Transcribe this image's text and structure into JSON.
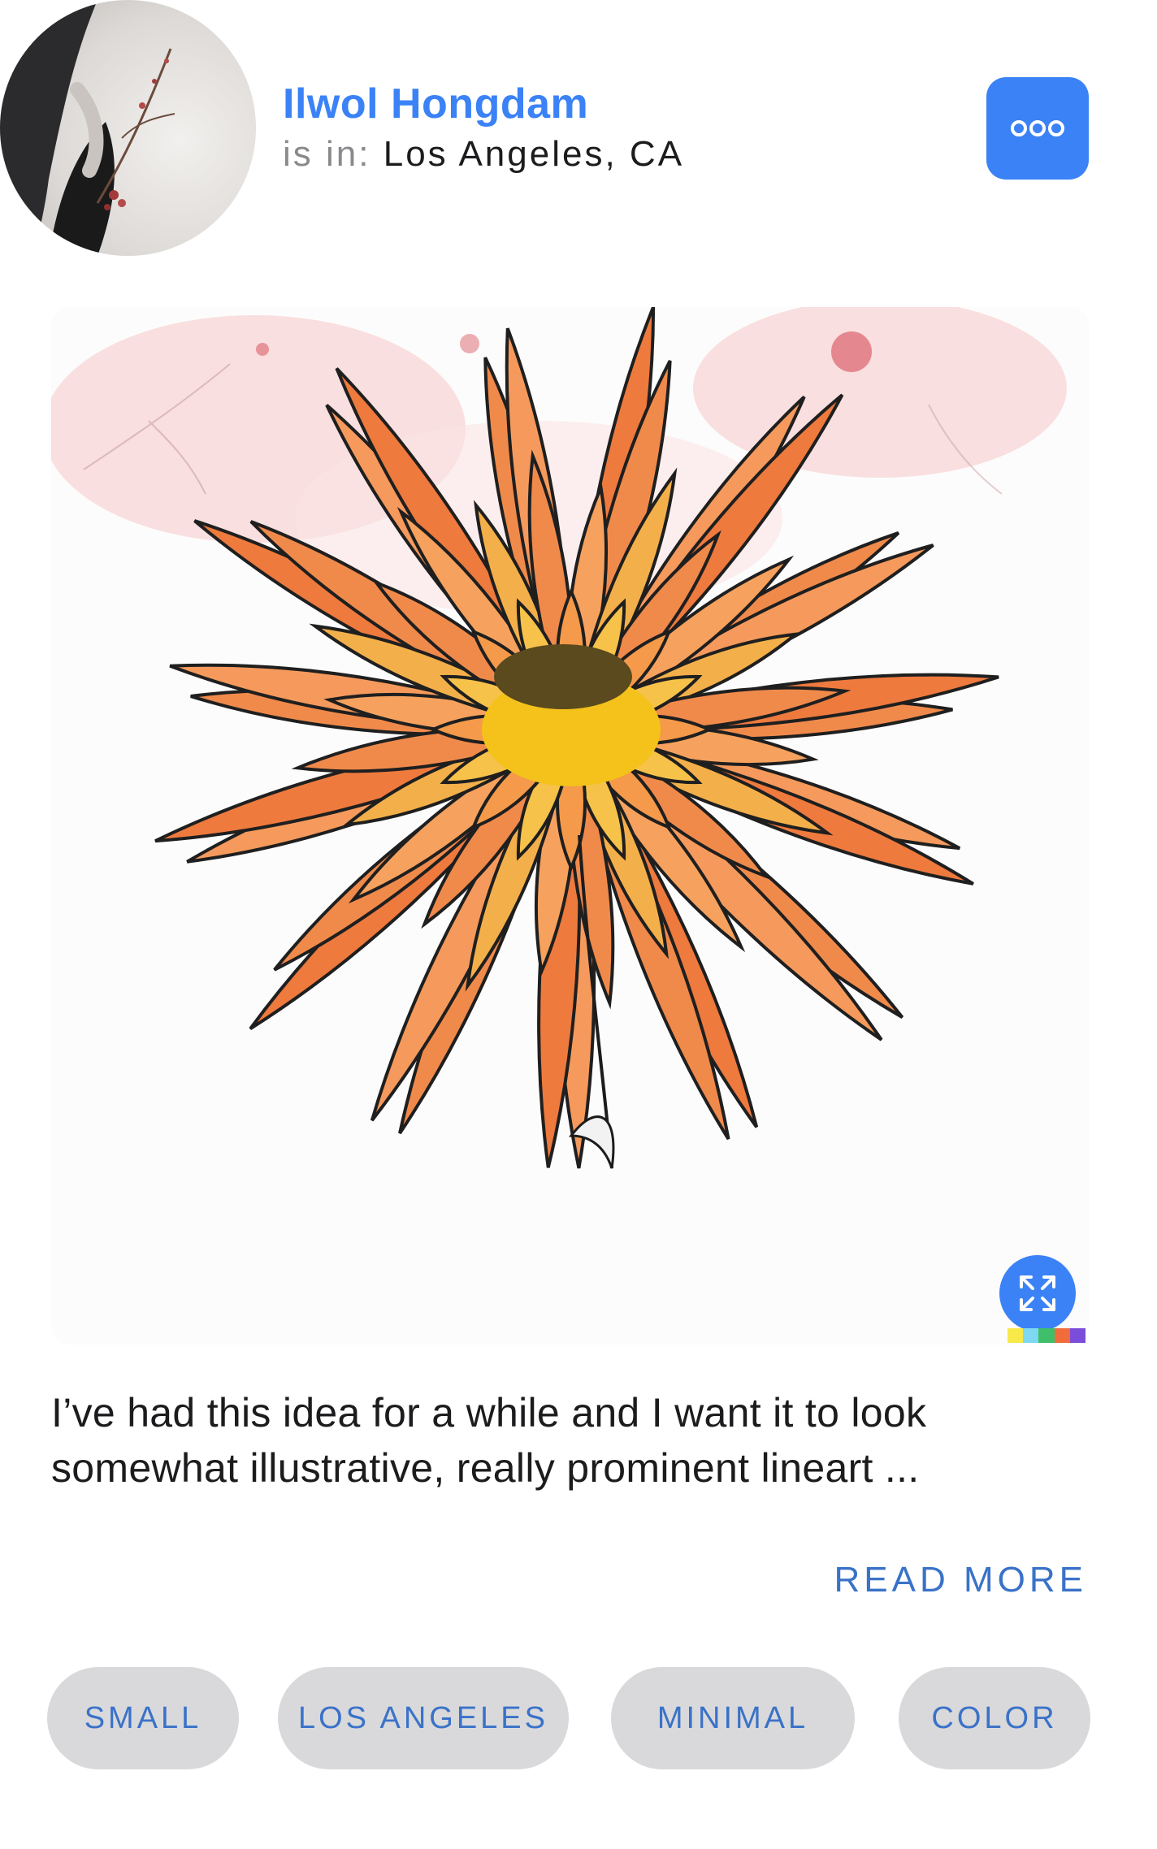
{
  "profile": {
    "name": "Ilwol Hongdam",
    "location_prefix": "is in:",
    "location": "Los Angeles, CA"
  },
  "icons": {
    "avatar": "avatar-photo",
    "more": "more-options-icon",
    "expand": "expand-icon"
  },
  "post": {
    "caption_line1": "I’ve had this idea for a while and I want it to look",
    "caption_line2": "somewhat illustrative, really prominent lineart ...",
    "read_more": "READ MORE"
  },
  "tags": [
    "SMALL",
    "LOS ANGELES",
    "MINIMAL",
    "COLOR"
  ],
  "colors": {
    "accent": "#3b82f6",
    "link": "#3a72c8",
    "tag_bg": "#d9d9db",
    "strip": [
      "#f7e94a",
      "#7ed8f2",
      "#3fbf6a",
      "#f26b3a",
      "#7b4ddb"
    ]
  }
}
